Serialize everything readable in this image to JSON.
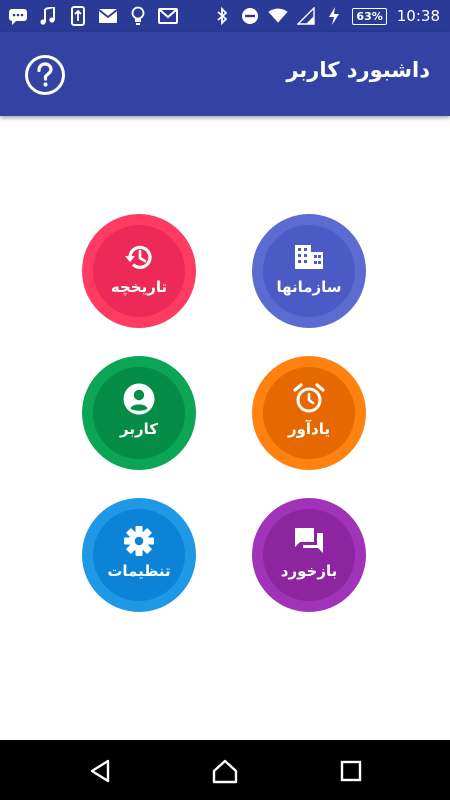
{
  "status_bar": {
    "left_icons": [
      "messages-icon",
      "music-icon",
      "usb-icon",
      "mail-icon",
      "lightbulb-icon",
      "gmail-icon"
    ],
    "right_icons": [
      "bluetooth-icon",
      "do-not-disturb-icon",
      "wifi-icon",
      "cell-signal-icon",
      "charging-icon"
    ],
    "battery": "63%",
    "time": "10:38"
  },
  "app_bar": {
    "title": "داشبورد کاربر",
    "help_icon": "help-icon"
  },
  "tiles": [
    {
      "label": "سازمانها",
      "icon": "building-icon",
      "color": "#5c6bd0"
    },
    {
      "label": "تاریخچه",
      "icon": "history-icon",
      "color": "#fe3c63"
    },
    {
      "label": "یادآور",
      "icon": "alarm-icon",
      "color": "#ff8210"
    },
    {
      "label": "کاربر",
      "icon": "account-icon",
      "color": "#0ca556"
    },
    {
      "label": "بازخورد",
      "icon": "feedback-icon",
      "color": "#a033b7"
    },
    {
      "label": "تنظیمات",
      "icon": "gear-icon",
      "color": "#1f98e5"
    }
  ],
  "nav_bar": {
    "buttons": [
      "back-icon",
      "home-icon",
      "recents-icon"
    ]
  },
  "colors": {
    "status_bar": "#2b3a97",
    "app_bar": "#3442a4",
    "nav_bar": "#000000"
  }
}
